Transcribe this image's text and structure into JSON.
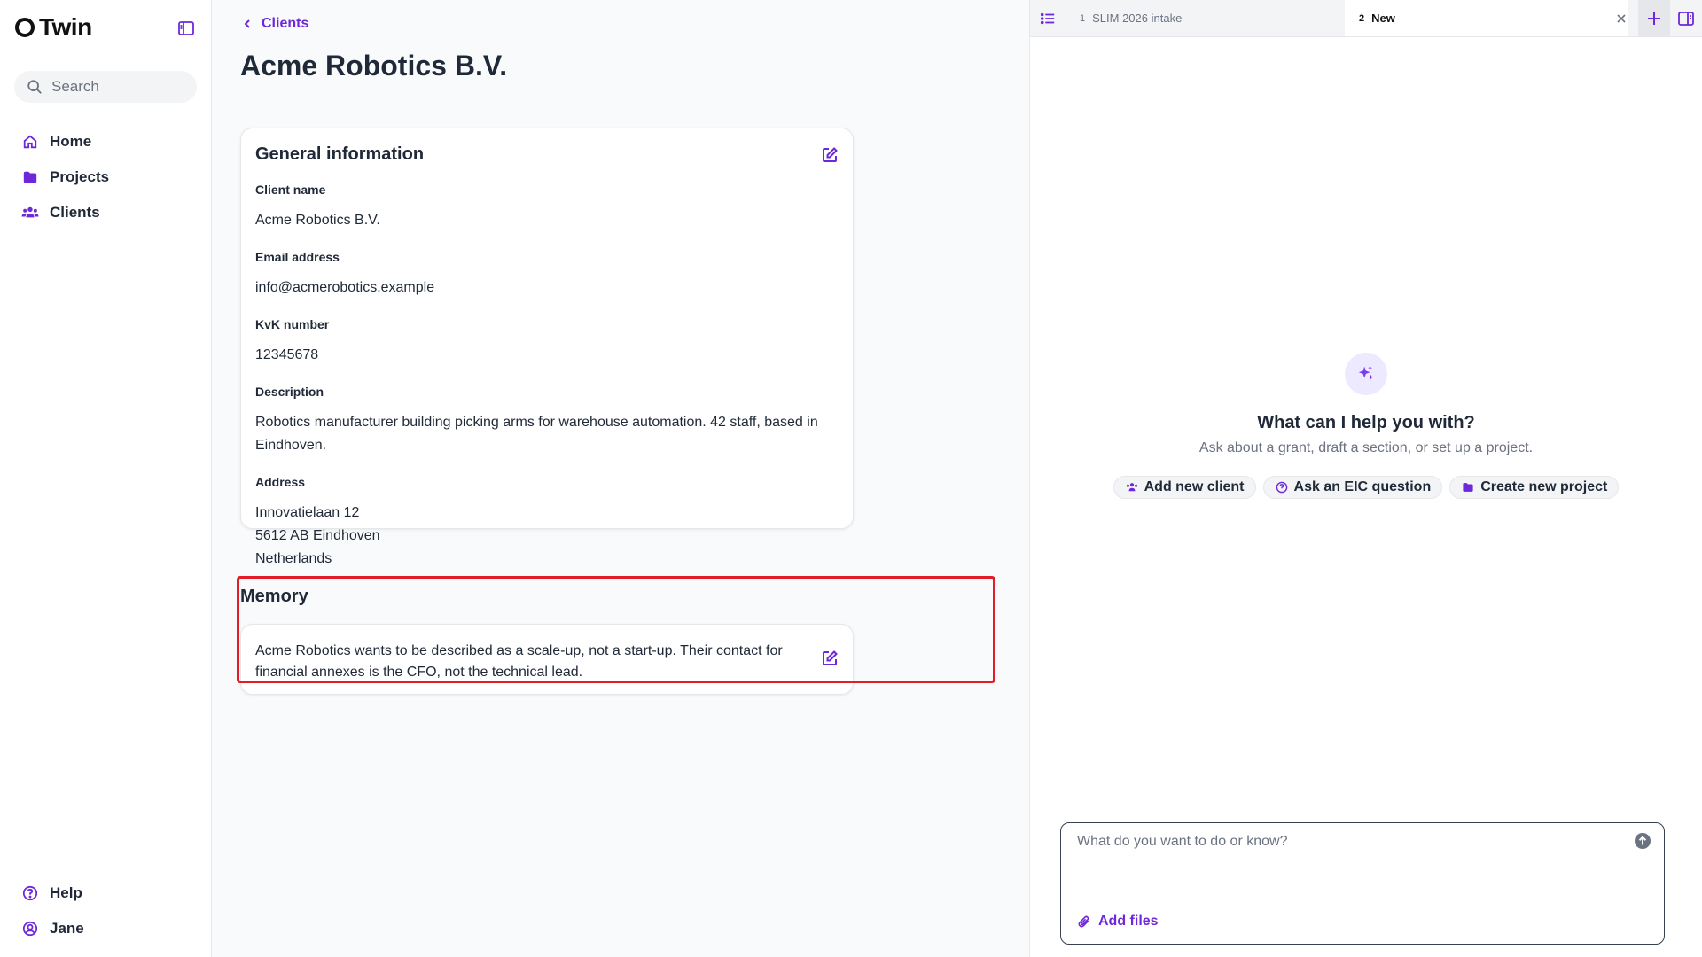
{
  "brand": {
    "name": "Twin"
  },
  "sidebar": {
    "search_placeholder": "Search",
    "items": [
      {
        "label": "Home",
        "icon": "home-icon"
      },
      {
        "label": "Projects",
        "icon": "folder-icon"
      },
      {
        "label": "Clients",
        "icon": "users-icon"
      }
    ],
    "bottom": [
      {
        "label": "Help",
        "icon": "help-icon"
      },
      {
        "label": "Jane",
        "icon": "user-icon"
      }
    ]
  },
  "main": {
    "breadcrumb": "Clients",
    "title": "Acme Robotics B.V.",
    "general": {
      "title": "General information",
      "fields": [
        {
          "label": "Client name",
          "value": "Acme Robotics B.V."
        },
        {
          "label": "Email address",
          "value": "info@acmerobotics.example"
        },
        {
          "label": "KvK number",
          "value": "12345678"
        },
        {
          "label": "Description",
          "value": "Robotics manufacturer building picking arms for warehouse automation. 42 staff, based in Eindhoven."
        },
        {
          "label": "Address",
          "lines": [
            "Innovatielaan 12",
            "5612 AB Eindhoven",
            "Netherlands"
          ]
        }
      ]
    },
    "memory": {
      "title": "Memory",
      "text": "Acme Robotics wants to be described as a scale-up, not a start-up. Their contact for financial annexes is the CFO, not the technical lead."
    }
  },
  "right": {
    "tabs": [
      {
        "num": "1",
        "label": "SLIM 2026 intake"
      },
      {
        "num": "2",
        "label": "New"
      }
    ],
    "help_title": "What can I help you with?",
    "help_subtitle": "Ask about a grant, draft a section, or set up a project.",
    "chips": [
      {
        "label": "Add new client",
        "icon": "users-icon"
      },
      {
        "label": "Ask an EIC question",
        "icon": "help-icon"
      },
      {
        "label": "Create new project",
        "icon": "folder-icon"
      }
    ],
    "composer_placeholder": "What do you want to do or know?",
    "add_files": "Add files"
  },
  "colors": {
    "accent": "#6d28d9",
    "highlight": "#e11d2a"
  }
}
